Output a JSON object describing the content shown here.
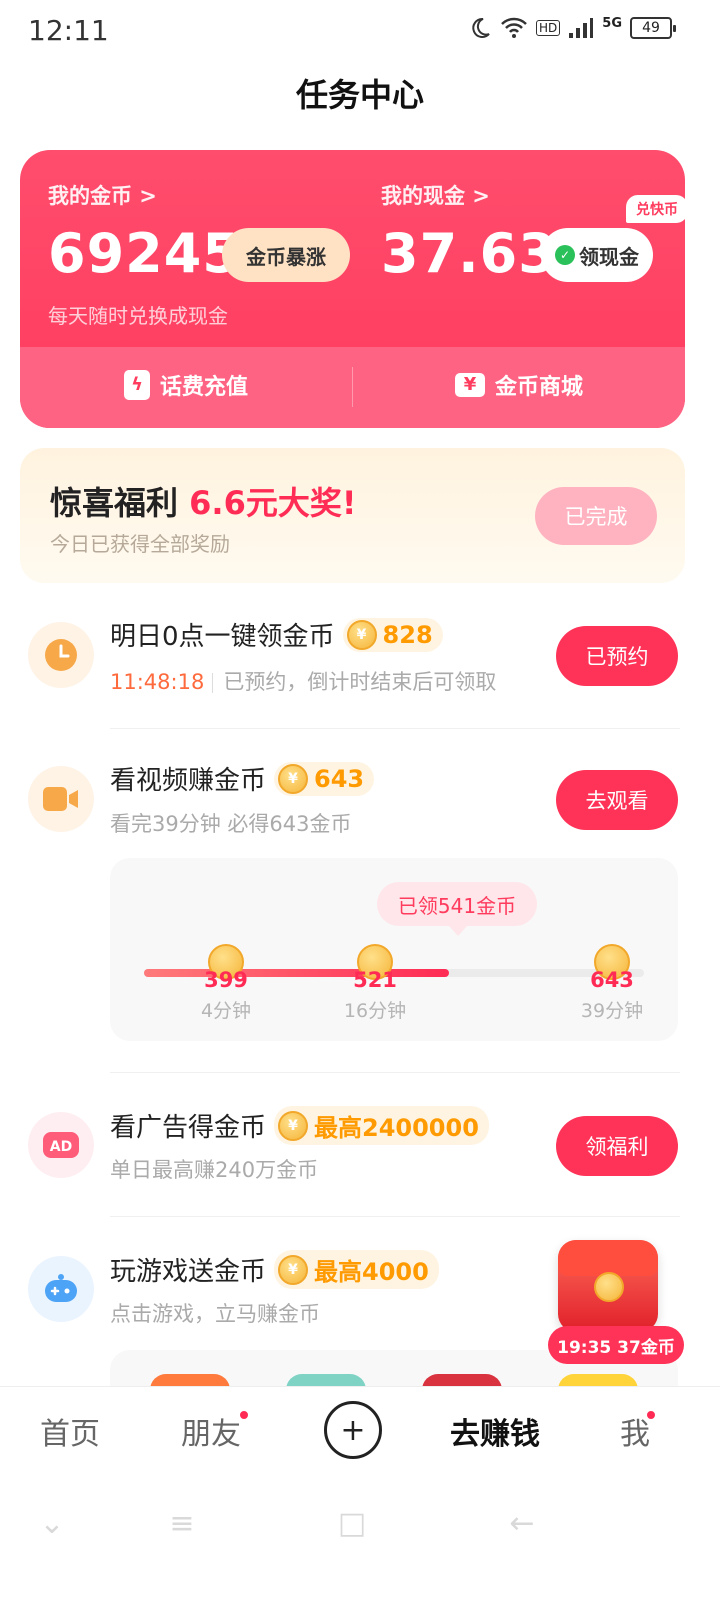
{
  "status_bar": {
    "time": "12:11",
    "network": "5G",
    "hd": "HD",
    "battery": "49"
  },
  "page": {
    "title": "任务中心"
  },
  "wallet": {
    "coins_label": "我的金币 >",
    "coins_value": "69245",
    "coins_badge": "金币暴涨",
    "cash_label": "我的现金 >",
    "cash_value": "37.63",
    "cash_button": "领现金",
    "hint": "每天随时兑换成现金",
    "recharge_label": "话费充值",
    "mall_label": "金币商城",
    "mall_badge": "兑快币"
  },
  "surprise": {
    "title": "惊喜福利",
    "highlight": "6.6元大奖!",
    "subtitle": "今日已获得全部奖励",
    "button": "已完成"
  },
  "tasks": [
    {
      "title": "明日0点一键领金币",
      "coins": "828",
      "countdown": "11:48:18",
      "subtitle": "已预约，倒计时结束后可领取",
      "button": "已预约",
      "icon": "clock-icon",
      "icon_color": "#f7a94a"
    },
    {
      "title": "看视频赚金币",
      "coins": "643",
      "subtitle": "看完39分钟 必得643金币",
      "button": "去观看",
      "icon": "video-icon",
      "icon_color": "#f7a94a"
    },
    {
      "title": "看广告得金币",
      "coins": "最高2400000",
      "subtitle": "单日最高赚240万金币",
      "button": "领福利",
      "icon": "ad-icon",
      "icon_color": "#ff5c7a"
    },
    {
      "title": "玩游戏送金币",
      "coins": "最高4000",
      "subtitle": "点击游戏，立马赚金币",
      "icon": "game-controller-icon",
      "icon_color": "#4da3f5"
    }
  ],
  "video_progress": {
    "tip": "已领541金币",
    "progress_fraction": 0.61,
    "milestones": [
      {
        "value": "399",
        "time": "4分钟"
      },
      {
        "value": "521",
        "time": "16分钟"
      },
      {
        "value": "643",
        "time": "39分钟"
      }
    ]
  },
  "redpack": {
    "label": "19:35 37金币"
  },
  "bottom_nav": {
    "home": "首页",
    "friends": "朋友",
    "plus": "+",
    "earn": "去赚钱",
    "me": "我"
  },
  "colors": {
    "accent": "#ff3358",
    "coin": "#ff9a00",
    "wallet_bg": "#ff4d6d"
  }
}
